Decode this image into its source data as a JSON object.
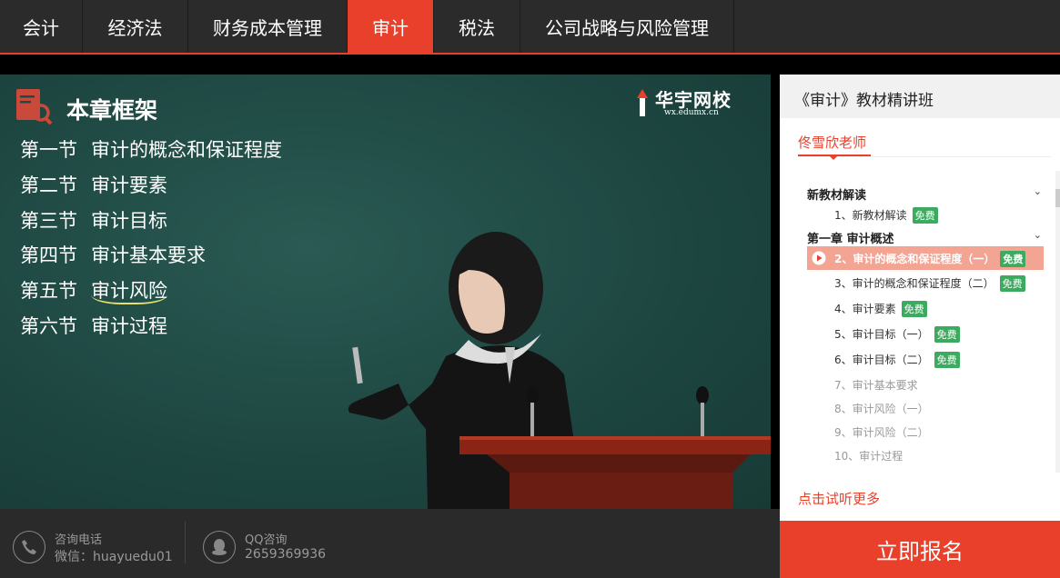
{
  "nav": {
    "tabs": [
      {
        "label": "会计"
      },
      {
        "label": "经济法"
      },
      {
        "label": "财务成本管理"
      },
      {
        "label": "审计"
      },
      {
        "label": "税法"
      },
      {
        "label": "公司战略与风险管理"
      }
    ],
    "active_tab": "审计"
  },
  "video": {
    "chapter_title": "本章框架",
    "sections": [
      {
        "num": "第一节",
        "title": "审计的概念和保证程度"
      },
      {
        "num": "第二节",
        "title": "审计要素"
      },
      {
        "num": "第三节",
        "title": "审计目标"
      },
      {
        "num": "第四节",
        "title": "审计基本要求"
      },
      {
        "num": "第五节",
        "title": "审计风险"
      },
      {
        "num": "第六节",
        "title": "审计过程"
      }
    ],
    "brand_name": "华宇网校",
    "brand_url": "wx.edumx.cn",
    "progress": 0.045
  },
  "contact": {
    "phone_label": "咨询电话",
    "wechat": "微信：huayuedu01",
    "qq_label": "QQ咨询",
    "qq_number": "2659369936"
  },
  "sidebar": {
    "title": "《审计》教材精讲班",
    "teacher": "佟雪欣老师",
    "free_badge": "免费",
    "chapter_1": "新教材解读",
    "chapter_2": "第一章 审计概述",
    "lessons": [
      {
        "label": "1、新教材解读",
        "free": true
      },
      {
        "label": "2、审计的概念和保证程度（一）",
        "free": true
      },
      {
        "label": "3、审计的概念和保证程度（二）",
        "free": true
      },
      {
        "label": "4、审计要素",
        "free": true
      },
      {
        "label": "5、审计目标（一）",
        "free": true
      },
      {
        "label": "6、审计目标（二）",
        "free": true
      },
      {
        "label": "7、审计基本要求",
        "free": false
      },
      {
        "label": "8、审计风险（一）",
        "free": false
      },
      {
        "label": "9、审计风险（二）",
        "free": false
      },
      {
        "label": "10、审计过程",
        "free": false
      }
    ],
    "more_link": "点击试听更多",
    "signup_label": "立即报名"
  },
  "colors": {
    "accent": "#e8402a",
    "free_badge": "#3cab5f",
    "board": "#1f4a44"
  }
}
